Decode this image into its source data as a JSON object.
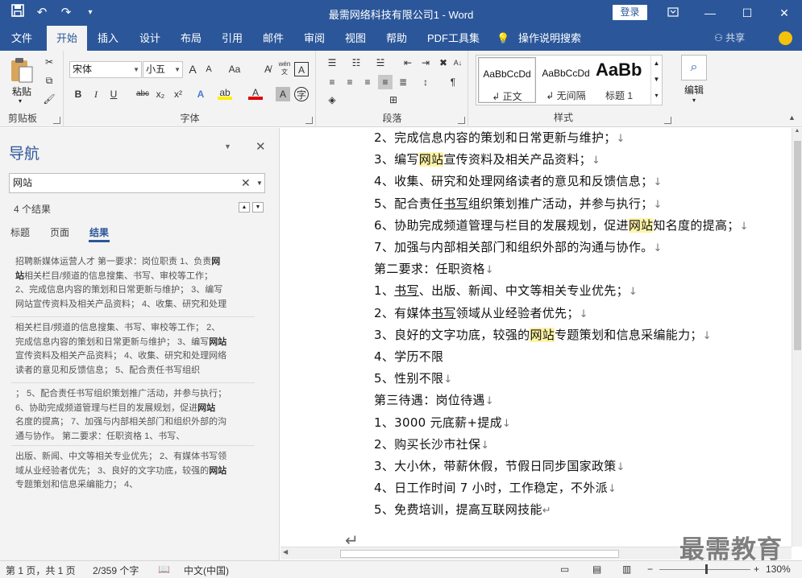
{
  "window": {
    "title": "最需网络科技有限公司1 - Word",
    "login_label": "登录",
    "qat": [
      "save-icon",
      "undo-icon",
      "redo-icon",
      "customize-icon"
    ]
  },
  "tabs": [
    "文件",
    "开始",
    "插入",
    "设计",
    "布局",
    "引用",
    "邮件",
    "审阅",
    "视图",
    "帮助",
    "PDF工具集",
    "操作说明搜索"
  ],
  "active_tab": "开始",
  "share_label": "共享",
  "ribbon": {
    "clipboard": {
      "paste_label": "粘贴",
      "group_label": "剪贴板"
    },
    "font": {
      "font_name": "宋体",
      "font_size": "小五",
      "group_label": "字体",
      "grow_label": "A",
      "shrink_label": "A",
      "case_label": "Aa",
      "bold": "B",
      "italic": "I",
      "underline": "U",
      "strike": "abc",
      "sub": "x₂",
      "sup": "x²",
      "wen_label": "wén",
      "border_char": "A"
    },
    "paragraph": {
      "group_label": "段落"
    },
    "styles": {
      "group_label": "样式",
      "items": [
        {
          "sample": "AaBbCcDd",
          "name": "↲ 正文"
        },
        {
          "sample": "AaBbCcDd",
          "name": "↲ 无间隔"
        },
        {
          "sample": "AaBb",
          "name": "标题 1"
        }
      ]
    },
    "editing": {
      "label": "编辑"
    }
  },
  "nav": {
    "title": "导航",
    "search_value": "网站",
    "result_count": "4 个结果",
    "tabs": [
      "标题",
      "页面",
      "结果"
    ],
    "results": [
      {
        "lines": [
          [
            [
              "招聘新媒体运营人才 第一要求：岗位职责 1、负责",
              false
            ],
            [
              "网",
              true
            ]
          ],
          [
            [
              "站",
              true
            ],
            [
              "相关栏目/频道的信息搜集、书写、审校等工作；",
              false
            ]
          ],
          [
            [
              "2、完成信息内容的策划和日常更新与维护； 3、编写",
              false
            ]
          ],
          [
            [
              "网站宣传资料及相关产品资料； 4、收集、研究和处理",
              false
            ]
          ]
        ]
      },
      {
        "lines": [
          [
            [
              "相关栏目/频道的信息搜集、书写、审校等工作； 2、",
              false
            ]
          ],
          [
            [
              "完成信息内容的策划和日常更新与维护； 3、编写",
              false
            ],
            [
              "网站",
              true
            ]
          ],
          [
            [
              "宣传资料及相关产品资料； 4、收集、研究和处理网络",
              false
            ]
          ],
          [
            [
              "读者的意见和反馈信息； 5、配合责任书写组织",
              false
            ]
          ]
        ]
      },
      {
        "lines": [
          [
            [
              "； 5、配合责任书写组织策划推广活动，并参与执行；",
              false
            ]
          ],
          [
            [
              "6、协助完成频道管理与栏目的发展规划，促进",
              false
            ],
            [
              "网站",
              true
            ]
          ],
          [
            [
              "名度的提高； 7、加强与内部相关部门和组织外部的沟",
              false
            ]
          ],
          [
            [
              "通与协作。 第二要求：任职资格 1、书写、",
              false
            ]
          ]
        ]
      },
      {
        "lines": [
          [
            [
              "出版、新闻、中文等相关专业优先； 2、有媒体书写领",
              false
            ]
          ],
          [
            [
              "域从业经验者优先； 3、良好的文字功底，较强的",
              false
            ],
            [
              "网站",
              true
            ]
          ],
          [
            [
              "专题策划和信息采编能力； 4、",
              false
            ]
          ]
        ]
      }
    ]
  },
  "document": {
    "lines": [
      [
        [
          "2、完成信息内容的策划和日常更新与维护；",
          ""
        ],
        [
          "↓",
          "mk"
        ]
      ],
      [
        [
          "3、编写",
          ""
        ],
        [
          "网站",
          "hl"
        ],
        [
          "宣传资料及相关产品资料；",
          ""
        ],
        [
          "↓",
          "mk"
        ]
      ],
      [
        [
          "4、收集、研究和处理网络读者的意见和反馈信息；",
          ""
        ],
        [
          "↓",
          "mk"
        ]
      ],
      [
        [
          "5、配合责任",
          ""
        ],
        [
          "书写",
          "ul"
        ],
        [
          "组织策划推广活动，并参与执行；",
          ""
        ],
        [
          "↓",
          "mk"
        ]
      ],
      [
        [
          "6、协助完成频道管理与栏目的发展规划，促进",
          ""
        ],
        [
          "网站",
          "hl"
        ],
        [
          "知名度的提高；",
          ""
        ],
        [
          "↓",
          "mk"
        ]
      ],
      [
        [
          "7、加强与内部相关部门和组织外部的沟通与协作。",
          ""
        ],
        [
          "↓",
          "mk"
        ]
      ],
      [
        [
          "第二要求：任职资格",
          ""
        ],
        [
          "↓",
          "mk"
        ]
      ],
      [
        [
          "1、",
          ""
        ],
        [
          "书写",
          "ul"
        ],
        [
          "、出版、新闻、中文等相关专业优先；",
          ""
        ],
        [
          "↓",
          "mk"
        ]
      ],
      [
        [
          "2、有媒体",
          ""
        ],
        [
          "书写",
          "ul"
        ],
        [
          "领域从业经验者优先；",
          ""
        ],
        [
          "↓",
          "mk"
        ]
      ],
      [
        [
          "3、良好的文字功底，较强的",
          ""
        ],
        [
          "网站",
          "hl"
        ],
        [
          "专题策划和信息采编能力；",
          ""
        ],
        [
          "↓",
          "mk"
        ]
      ],
      [
        [
          "4、学历不限",
          ""
        ]
      ],
      [
        [
          "5、性别不限",
          ""
        ],
        [
          "↓",
          "mk"
        ]
      ],
      [
        [
          "第三待遇：岗位待遇",
          ""
        ],
        [
          "↓",
          "mk"
        ]
      ],
      [
        [
          "1、3000 元底薪+提成",
          ""
        ],
        [
          "↓",
          "mk"
        ]
      ],
      [
        [
          "2、购买长沙市社保",
          ""
        ],
        [
          "↓",
          "mk"
        ]
      ],
      [
        [
          "3、大小休，带薪休假，节假日同步国家政策",
          ""
        ],
        [
          "↓",
          "mk"
        ]
      ],
      [
        [
          "4、日工作时间 7 小时，工作稳定，不外派",
          ""
        ],
        [
          "↓",
          "mk"
        ]
      ],
      [
        [
          "5、免费培训，提高互联网技能",
          ""
        ],
        [
          "↵",
          "mk"
        ]
      ]
    ]
  },
  "status": {
    "page": "第 1 页，共 1 页",
    "words": "2/359 个字",
    "language": "中文(中国)",
    "zoom": "130%"
  },
  "watermark": "最需教育"
}
